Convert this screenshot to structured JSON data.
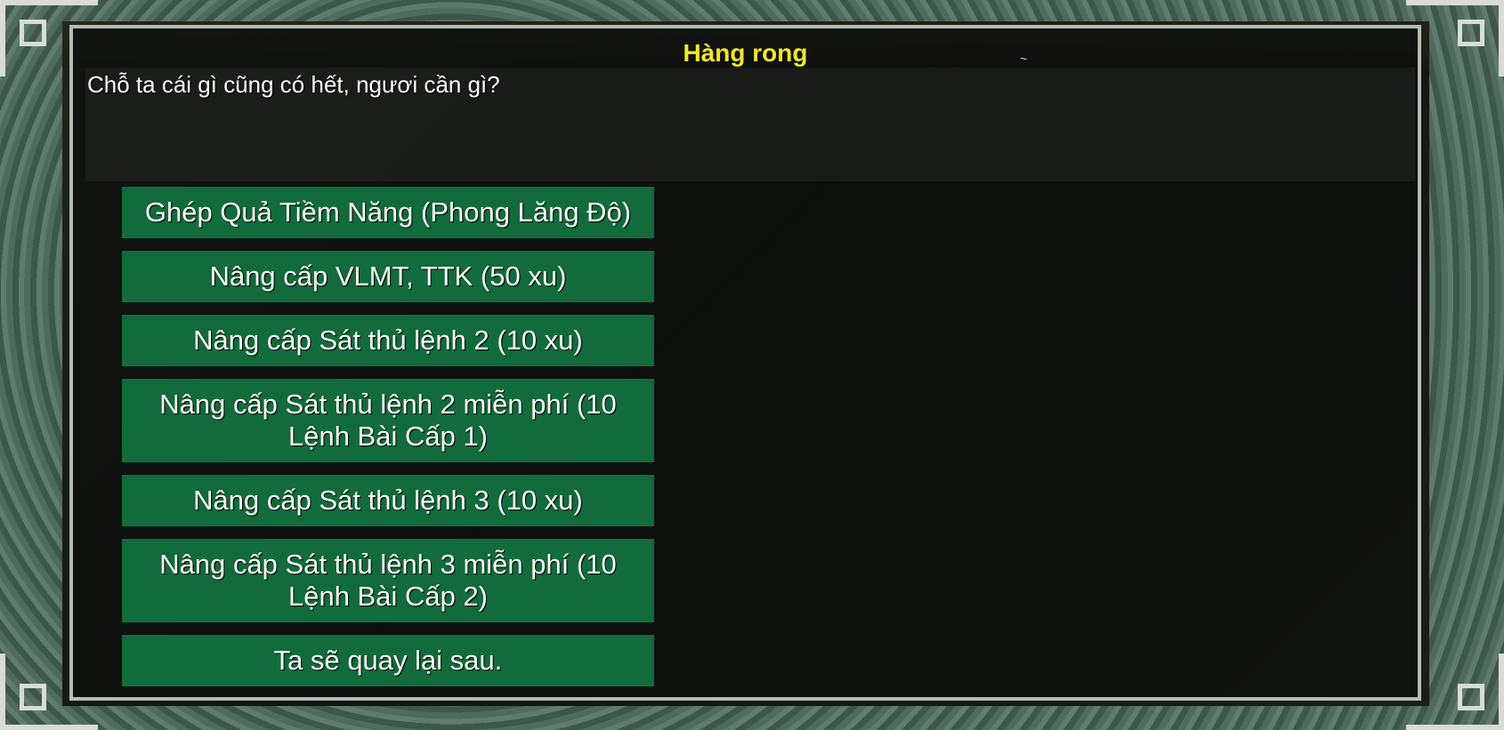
{
  "dialog": {
    "title": "Hàng rong",
    "title_mark": "~",
    "greeting": "Chỗ ta cái gì cũng có hết, ngươi cần gì?",
    "options": [
      "Ghép Quả Tiềm Năng (Phong Lăng Độ)",
      "Nâng cấp VLMT, TTK (50 xu)",
      "Nâng cấp Sát thủ lệnh 2 (10 xu)",
      "Nâng cấp Sát thủ lệnh 2 miễn phí (10 Lệnh Bài Cấp 1)",
      "Nâng cấp Sát thủ lệnh 3 (10 xu)",
      "Nâng cấp Sát thủ lệnh 3 miễn phí (10 Lệnh Bài Cấp 2)",
      "Ta sẽ quay lại sau."
    ]
  },
  "colors": {
    "title": "#f3ea1c",
    "option_bg": "#126b3a",
    "frame_border": "#b8bab4"
  }
}
